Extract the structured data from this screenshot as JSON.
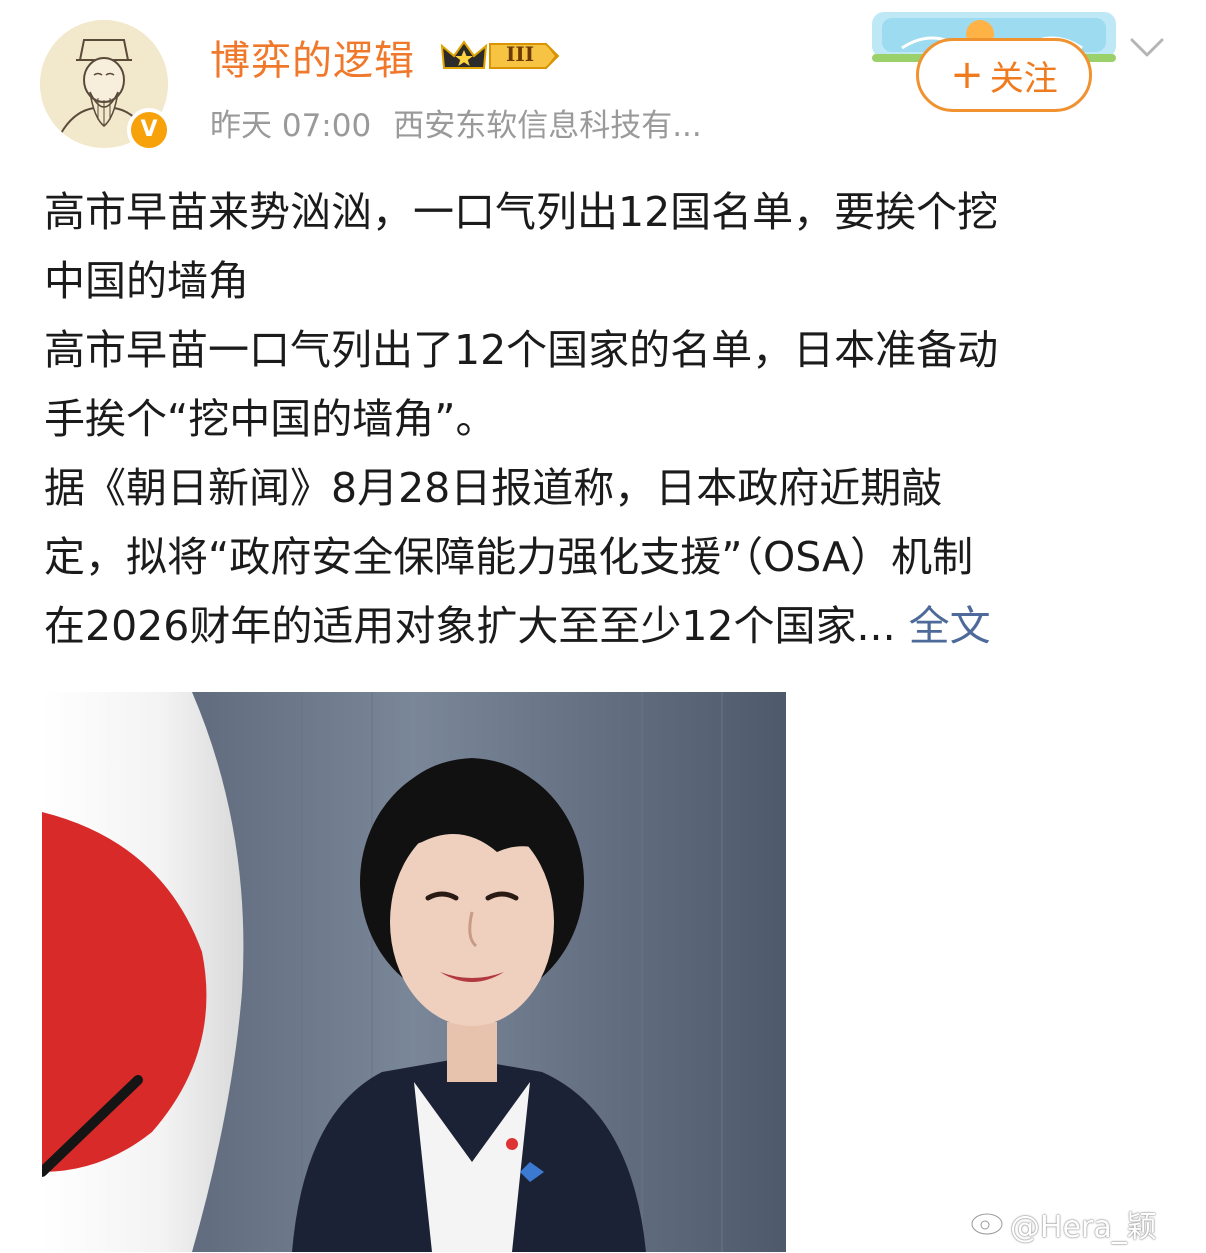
{
  "user": {
    "name": "博弈的逻辑",
    "level_badge": "III",
    "verified_mark": "V"
  },
  "meta": {
    "time": "昨天 07:00",
    "source": "西安东软信息科技有..."
  },
  "follow_button": {
    "plus": "+",
    "label": "关注"
  },
  "post": {
    "lines": [
      "高市早苗来势汹汹，一口气列出12国名单，要挨个挖",
      "中国的墙角",
      "高市早苗一口气列出了12个国家的名单，日本准备动",
      "手挨个“挖中国的墙角”。",
      "据《朝日新闻》8月28日报道称，日本政府近期敲",
      "定，拟将“政府安全保障能力强化支援”（OSA）机制"
    ],
    "last_line": "在2026财年的适用对象扩大至至少12个国家...",
    "full_text_link": "全文"
  },
  "watermark": "@Hera_颖",
  "icons": {
    "avatar": "portrait-avatar",
    "verified": "verified-v-icon",
    "crown": "crown-icon",
    "menu": "chevron-down-icon",
    "watermark": "weibo-logo-icon"
  },
  "colors": {
    "username": "#f0782b",
    "follow": "#f07a1e",
    "link": "#4d6a9a",
    "meta": "#9a9a9a",
    "text": "#1b1b1b"
  }
}
